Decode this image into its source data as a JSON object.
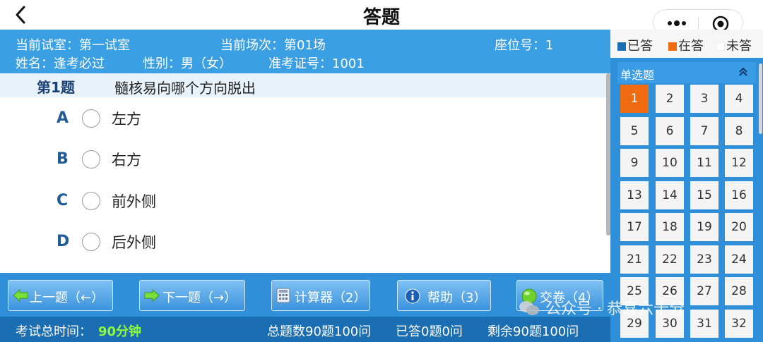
{
  "nav": {
    "title": "答题",
    "back_icon": "chevron-left-icon",
    "more_icon": "more-dots-icon",
    "close_icon": "target-circle-icon"
  },
  "info": {
    "room": "当前试室：第一试室",
    "session": "当前场次：第01场",
    "seat": "座位号：1",
    "name": "姓名：逢考必过",
    "gender": "性别：男（女）",
    "ticket": "准考证号：1001"
  },
  "question": {
    "number": "第1题",
    "text": "髓核易向哪个方向脱出",
    "options": [
      {
        "letter": "A",
        "text": "左方"
      },
      {
        "letter": "B",
        "text": "右方"
      },
      {
        "letter": "C",
        "text": "前外侧"
      },
      {
        "letter": "D",
        "text": "后外侧"
      }
    ]
  },
  "buttons": {
    "prev": "上一题（←）",
    "next": "下一题（→）",
    "calc": "计算器（2）",
    "help": "帮助（3）",
    "submit": "交卷（4）"
  },
  "status": {
    "time_label": "考试总时间：",
    "time_value": "90分钟",
    "total": "总题数90题100问",
    "answered": "已答0题0问",
    "remaining": "剩余90题100问"
  },
  "legend": {
    "answered": "已答",
    "answering": "在答",
    "unanswered": "未答"
  },
  "colors": {
    "answered": "#1c6eb3",
    "answering": "#f06a10",
    "unanswered": "#ffffff",
    "header_blue": "#3b9fe4",
    "accent_green": "#8dfb3a"
  },
  "panel": {
    "section": "单选题",
    "cells": [
      "1",
      "2",
      "3",
      "4",
      "5",
      "6",
      "7",
      "8",
      "9",
      "10",
      "11",
      "12",
      "13",
      "14",
      "15",
      "16",
      "17",
      "18",
      "19",
      "20",
      "21",
      "22",
      "23",
      "24",
      "25",
      "26",
      "27",
      "28",
      "29",
      "30",
      "31",
      "32"
    ],
    "current": "1"
  },
  "watermark": "公众号 · 恭喜六十分"
}
